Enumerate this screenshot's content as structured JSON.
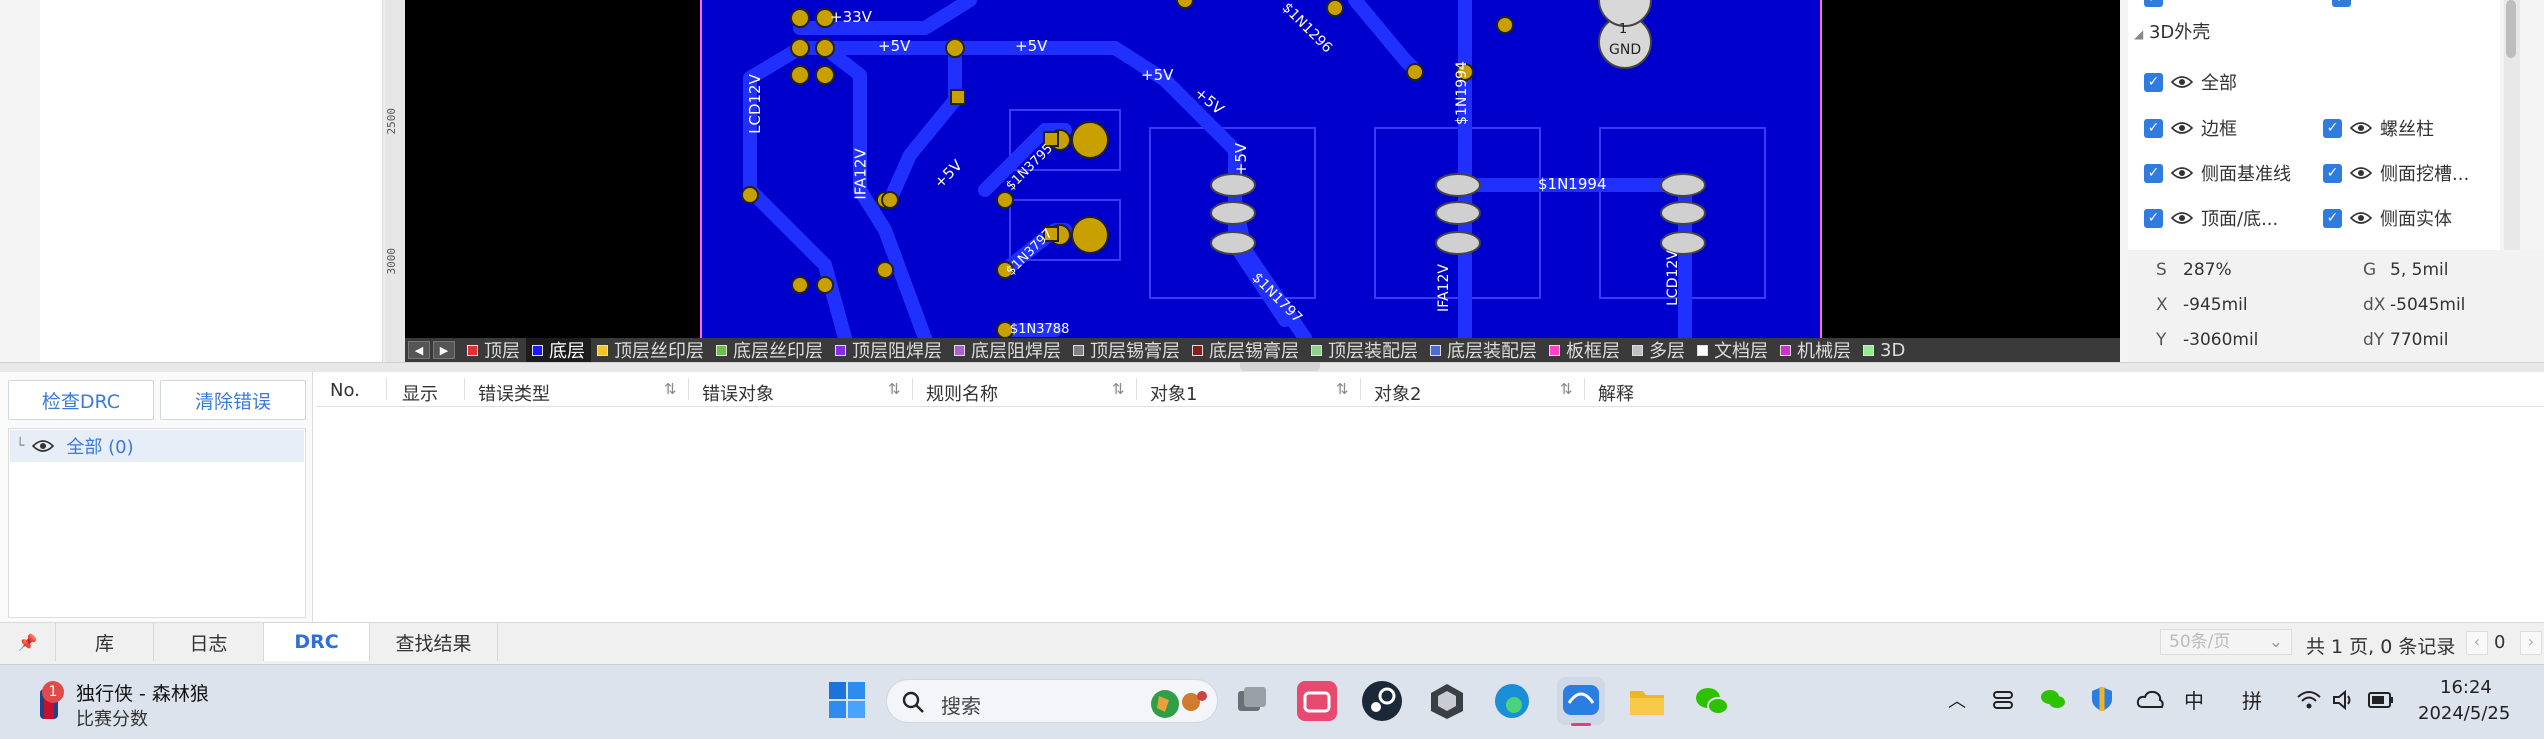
{
  "canvas": {
    "ruler_labels": [
      "2500",
      "3000"
    ],
    "net_labels": [
      "+33V",
      "+5V",
      "+5V",
      "+5V",
      "+5V",
      "+5V",
      "+5V",
      "LCD12V",
      "IFA12V",
      "$1N1296",
      "$1N1994",
      "$1N1994",
      "$1N3795",
      "$1N3797",
      "$1N1797",
      "$1N3788",
      "GND",
      "LCD12V",
      "IFA12V"
    ],
    "gnd_label": "GND",
    "pad_number": "1"
  },
  "layer_bar": {
    "nav_prev": "◀",
    "nav_next": "▶",
    "layers": [
      {
        "label": "顶层",
        "color": "#e03030",
        "active": false
      },
      {
        "label": "底层",
        "color": "#1a1aff",
        "active": true
      },
      {
        "label": "顶层丝印层",
        "color": "#f2c12e",
        "active": false
      },
      {
        "label": "底层丝印层",
        "color": "#6abf45",
        "active": false
      },
      {
        "label": "顶层阻焊层",
        "color": "#8a2be2",
        "active": false
      },
      {
        "label": "底层阻焊层",
        "color": "#b05fd0",
        "active": false
      },
      {
        "label": "顶层锡膏层",
        "color": "#808080",
        "active": false
      },
      {
        "label": "底层锡膏层",
        "color": "#8b1a1a",
        "active": false
      },
      {
        "label": "顶层装配层",
        "color": "#8fd18f",
        "active": false
      },
      {
        "label": "底层装配层",
        "color": "#4b6bd8",
        "active": false
      },
      {
        "label": "板框层",
        "color": "#ff44cc",
        "active": false
      },
      {
        "label": "多层",
        "color": "#c0c0c0",
        "active": false
      },
      {
        "label": "文档层",
        "color": "#ffffff",
        "active": false
      },
      {
        "label": "机械层",
        "color": "#cc33cc",
        "active": false
      },
      {
        "label": "3D",
        "color": "#90ee90",
        "active": false
      }
    ]
  },
  "right_panel": {
    "section_title": "3D外壳",
    "options": [
      {
        "left": "全部",
        "right": ""
      },
      {
        "left": "边框",
        "right": "螺丝柱"
      },
      {
        "left": "侧面基准线",
        "right": "侧面挖槽..."
      },
      {
        "left": "顶面/底...",
        "right": "侧面实体"
      }
    ],
    "coords": {
      "s_label": "S",
      "s_value": "287%",
      "g_label": "G",
      "g_value": "5, 5mil",
      "x_label": "X",
      "x_value": "-945mil",
      "dx_label": "dX",
      "dx_value": "-5045mil",
      "y_label": "Y",
      "y_value": "-3060mil",
      "dy_label": "dY",
      "dy_value": "770mil"
    }
  },
  "drc": {
    "check_button": "检查DRC",
    "clear_button": "清除错误",
    "tree_root": "全部 (0)",
    "columns": [
      "No.",
      "显示",
      "错误类型",
      "错误对象",
      "规则名称",
      "对象1",
      "对象2",
      "解释"
    ]
  },
  "bottom_tabs": {
    "pin_icon": "pin-icon",
    "tabs": [
      {
        "label": "库",
        "active": false
      },
      {
        "label": "日志",
        "active": false
      },
      {
        "label": "DRC",
        "active": true
      },
      {
        "label": "查找结果",
        "active": false
      }
    ],
    "page_size": "50条/页",
    "summary": "共 1 页, 0 条记录",
    "page_input": "0"
  },
  "taskbar": {
    "widget_title": "独行侠 - 森林狼",
    "widget_subtitle": "比赛分数",
    "widget_badge": "1",
    "search_placeholder": "搜索",
    "ime_mode": "中",
    "ime_input": "拼",
    "time": "16:24",
    "date": "2024/5/25"
  }
}
